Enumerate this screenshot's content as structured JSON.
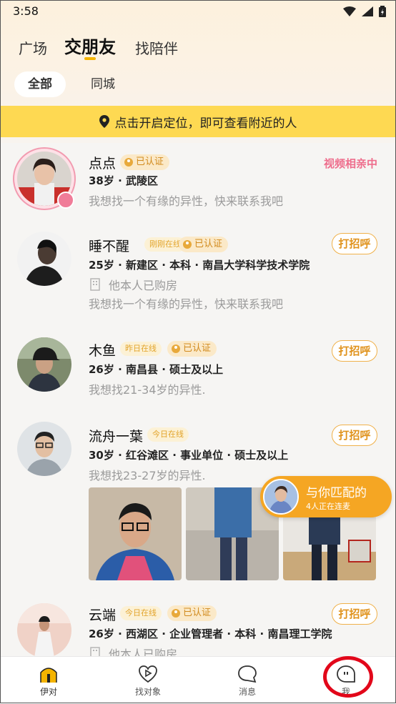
{
  "status_bar": {
    "time": "3:58"
  },
  "top_tabs": [
    {
      "label": "广场",
      "active": false
    },
    {
      "label": "交朋友",
      "active": true
    },
    {
      "label": "找陪伴",
      "active": false
    }
  ],
  "filters": [
    {
      "label": "全部",
      "active": true
    },
    {
      "label": "同城",
      "active": false
    }
  ],
  "location_banner": "点击开启定位，即可查看附近的人",
  "users": [
    {
      "name": "点点",
      "verified": "已认证",
      "info": "38岁 · 武陵区",
      "bio": "我想找一个有缘的异性，快来联系我吧",
      "status": "视频相亲中"
    },
    {
      "name": "睡不醒",
      "online": "刚刚在线",
      "verified": "已认证",
      "info": "25岁 · 新建区 · 本科 · 南昌大学科学技术学院",
      "house": "他本人已购房",
      "bio": "我想找一个有缘的异性，快来联系我吧",
      "action": "打招呼"
    },
    {
      "name": "木鱼",
      "online": "昨日在线",
      "verified": "已认证",
      "info": "26岁 · 南昌县 · 硕士及以上",
      "bio": "我想找21-34岁的异性.",
      "action": "打招呼"
    },
    {
      "name": "流舟一葉",
      "online": "今日在线",
      "info": "30岁 · 红谷滩区 · 事业单位 · 硕士及以上",
      "bio": "我想找23-27岁的异性.",
      "action": "打招呼"
    },
    {
      "name": "云端",
      "online": "今日在线",
      "verified": "已认证",
      "info": "26岁 · 西湖区 · 企业管理者 · 本科 · 南昌理工学院",
      "house": "他本人已购房",
      "action": "打招呼"
    }
  ],
  "match_float": {
    "title": "与你匹配的",
    "subtitle": "4人正在连麦"
  },
  "bottom_nav": [
    {
      "label": "伊对",
      "icon": "home-icon",
      "active": true
    },
    {
      "label": "找对象",
      "icon": "heart-play-icon",
      "active": false
    },
    {
      "label": "消息",
      "icon": "chat-bubble-icon",
      "active": false
    },
    {
      "label": "我",
      "icon": "profile-face-icon",
      "active": false
    }
  ],
  "colors": {
    "accent": "#f5b400",
    "banner": "#fed952",
    "pink": "#ee6d8c",
    "annotation": "#e2071a"
  }
}
